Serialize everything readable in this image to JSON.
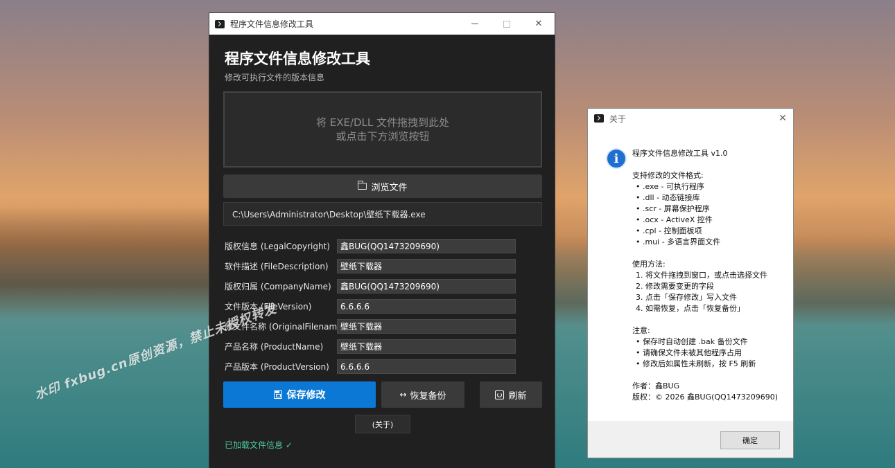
{
  "main_window": {
    "title": "程序文件信息修改工具",
    "controls": {
      "minimize": "—",
      "close": "✕"
    },
    "heading": "程序文件信息修改工具",
    "subtitle": "修改可执行文件的版本信息",
    "dropzone": {
      "line1": "将 EXE/DLL 文件拖拽到此处",
      "line2": "或点击下方浏览按钮"
    },
    "browse_button": "浏览文件",
    "file_path": "C:\\Users\\Administrator\\Desktop\\壁纸下载器.exe",
    "fields": [
      {
        "label": "版权信息 (LegalCopyright)",
        "value": "鑫BUG(QQ1473209690)"
      },
      {
        "label": "软件描述 (FileDescription)",
        "value": "壁纸下载器"
      },
      {
        "label": "版权归属 (CompanyName)",
        "value": "鑫BUG(QQ1473209690)"
      },
      {
        "label": "文件版本 (FileVersion)",
        "value": "6.6.6.6"
      },
      {
        "label": "原文件名称 (OriginalFilenam",
        "value": "壁纸下载器"
      },
      {
        "label": "产品名称 (ProductName)",
        "value": "壁纸下载器"
      },
      {
        "label": "产品版本 (ProductVersion)",
        "value": "6.6.6.6"
      }
    ],
    "buttons": {
      "save": "保存修改",
      "restore_arrow": "↔",
      "restore": "恢复备份",
      "refresh": "刷新",
      "about": "(关于)"
    },
    "status": "已加载文件信息 ✓"
  },
  "watermark": "水印 fxbug.cn原创资源，禁止未授权转发",
  "about_dialog": {
    "title": "关于",
    "close": "✕",
    "icon_glyph": "i",
    "app_version": "程序文件信息修改工具 v1.0",
    "formats_header": "支持修改的文件格式:",
    "formats": [
      "• .exe  - 可执行程序",
      "• .dll  - 动态链接库",
      "• .scr  - 屏幕保护程序",
      "• .ocx  - ActiveX 控件",
      "• .cpl  - 控制面板项",
      "• .mui  - 多语言界面文件"
    ],
    "usage_header": "使用方法:",
    "usage": [
      "1. 将文件拖拽到窗口，或点击选择文件",
      "2. 修改需要变更的字段",
      "3. 点击「保存修改」写入文件",
      "4. 如需恢复，点击「恢复备份」"
    ],
    "notes_header": "注意:",
    "notes": [
      "• 保存时自动创建 .bak 备份文件",
      "• 请确保文件未被其他程序占用",
      "• 修改后如属性未刷新，按 F5 刷新"
    ],
    "author": "作者：鑫BUG",
    "copyright": "版权：© 2026 鑫BUG(QQ1473209690)",
    "ok_button": "确定"
  },
  "colors": {
    "accent": "#0a78d4",
    "status": "#4ec9a0",
    "info_icon": "#1f6fd1"
  }
}
